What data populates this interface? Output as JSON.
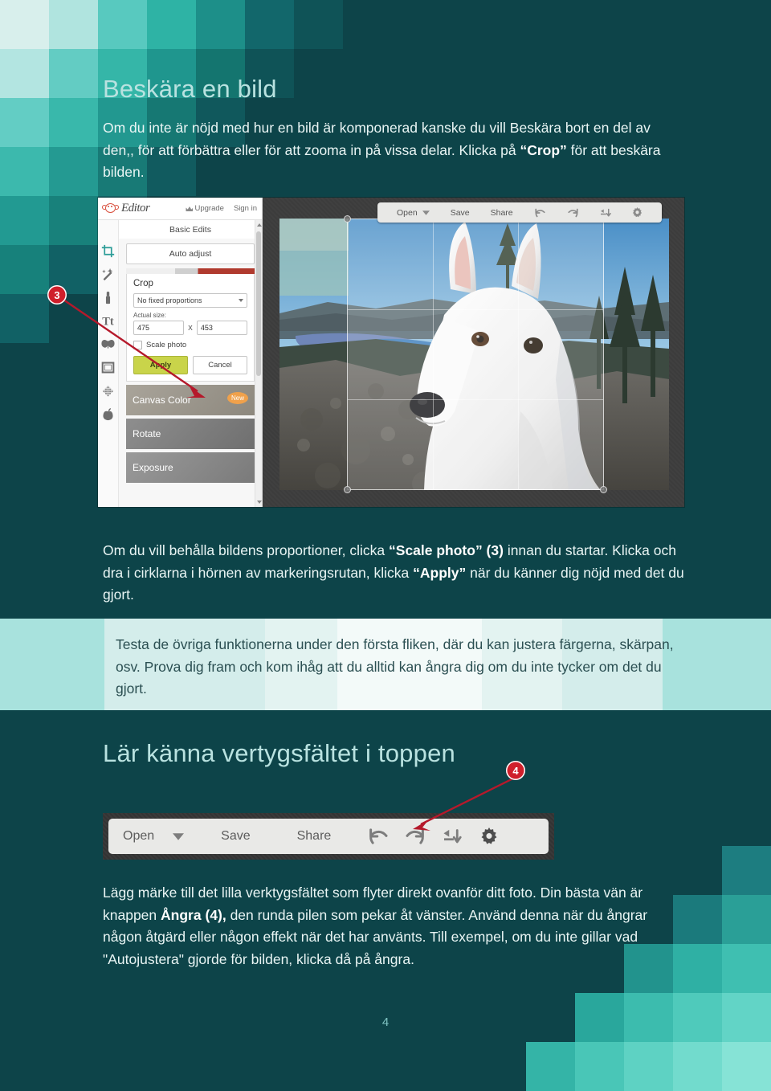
{
  "page": {
    "number": "4",
    "background_color": "#0d4449",
    "accent_color": "#2b9c97",
    "callout_color": "#cf1f2b"
  },
  "sections": {
    "heading_crop": "Beskära en bild",
    "intro_paragraph": "Om du inte är nöjd med hur en bild är komponerad kanske du vill Beskära bort en del av den,, för att förbättra eller för att zooma in på vissa delar. Klicka på ",
    "intro_bold": "“Crop”",
    "intro_paragraph_end": " för att beskära bilden.",
    "mid_paragraph_a": "Om du vill behålla bildens proportioner, clicka ",
    "mid_bold_a": "“Scale photo” (3)",
    "mid_paragraph_b": " innan du startar. Klicka och dra i cirklarna i hörnen av markeringsrutan, klicka ",
    "mid_bold_b": "“Apply”",
    "mid_paragraph_c": " när du känner dig nöjd med det du gjort.",
    "band_paragraph": "Testa de övriga funktionerna under den första fliken, där du kan justera färgerna, skärpan, osv. Prova dig fram och kom ihåg att du alltid kan ångra dig om du inte tycker om det du gjort.",
    "heading_toolbar": "Lär känna vertygsfältet i toppen",
    "bottom_paragraph_a": "Lägg märke till det lilla verktygsfältet som flyter direkt ovanför ditt foto. Din bästa vän är knappen ",
    "bottom_bold": "Ångra (4),",
    "bottom_paragraph_b": " den runda pilen som pekar åt vänster. Använd denna när du ångrar någon åtgärd eller någon effekt när det har använts. Till exempel, om du inte gillar vad \"Autojustera\" gjorde för bilden, klicka då på ångra."
  },
  "callouts": [
    {
      "id": "3",
      "label": "3"
    },
    {
      "id": "4",
      "label": "4"
    }
  ],
  "editor_screenshot": {
    "brand": "Editor",
    "header_links": [
      "Upgrade",
      "Sign in"
    ],
    "panel_title": "Basic Edits",
    "auto_adjust_label": "Auto adjust",
    "crop_panel": {
      "title": "Crop",
      "proportions_value": "No fixed proportions",
      "actual_size_label": "Actual size:",
      "width_value": "475",
      "size_separator": "X",
      "height_value": "453",
      "scale_photo_label": "Scale photo",
      "apply_label": "Apply",
      "cancel_label": "Cancel"
    },
    "tiles": [
      {
        "label": "Canvas Color",
        "badge": "New"
      },
      {
        "label": "Rotate",
        "badge": ""
      },
      {
        "label": "Exposure",
        "badge": ""
      }
    ],
    "rail_icons": [
      "crop-icon",
      "magic-wand-icon",
      "touch-up-icon",
      "text-icon",
      "butterfly-overlay-icon",
      "frame-icon",
      "texture-icon",
      "apple-theme-icon"
    ],
    "toolbar": {
      "open_label": "Open",
      "save_label": "Save",
      "share_label": "Share",
      "icons": [
        "undo-icon",
        "redo-icon",
        "download-icon",
        "gear-icon"
      ]
    }
  },
  "toolbar_screenshot": {
    "open_label": "Open",
    "save_label": "Save",
    "share_label": "Share",
    "icons": [
      "undo-icon",
      "redo-icon",
      "download-icon",
      "gear-icon"
    ]
  }
}
